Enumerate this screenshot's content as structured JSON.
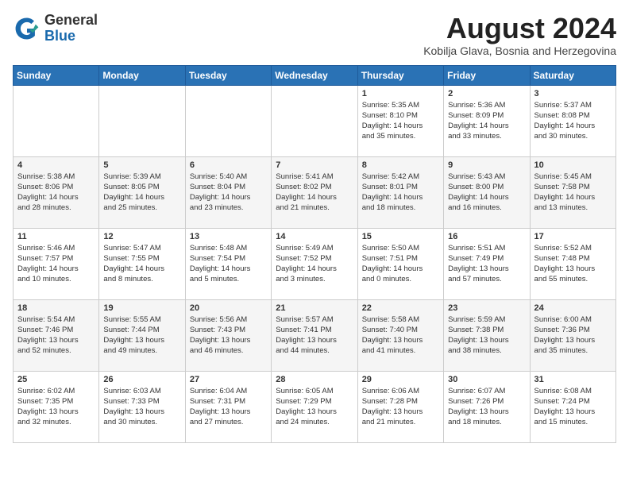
{
  "header": {
    "logo_general": "General",
    "logo_blue": "Blue",
    "title": "August 2024",
    "subtitle": "Kobilja Glava, Bosnia and Herzegovina"
  },
  "days_of_week": [
    "Sunday",
    "Monday",
    "Tuesday",
    "Wednesday",
    "Thursday",
    "Friday",
    "Saturday"
  ],
  "weeks": [
    [
      {
        "day": "",
        "info": ""
      },
      {
        "day": "",
        "info": ""
      },
      {
        "day": "",
        "info": ""
      },
      {
        "day": "",
        "info": ""
      },
      {
        "day": "1",
        "info": "Sunrise: 5:35 AM\nSunset: 8:10 PM\nDaylight: 14 hours\nand 35 minutes."
      },
      {
        "day": "2",
        "info": "Sunrise: 5:36 AM\nSunset: 8:09 PM\nDaylight: 14 hours\nand 33 minutes."
      },
      {
        "day": "3",
        "info": "Sunrise: 5:37 AM\nSunset: 8:08 PM\nDaylight: 14 hours\nand 30 minutes."
      }
    ],
    [
      {
        "day": "4",
        "info": "Sunrise: 5:38 AM\nSunset: 8:06 PM\nDaylight: 14 hours\nand 28 minutes."
      },
      {
        "day": "5",
        "info": "Sunrise: 5:39 AM\nSunset: 8:05 PM\nDaylight: 14 hours\nand 25 minutes."
      },
      {
        "day": "6",
        "info": "Sunrise: 5:40 AM\nSunset: 8:04 PM\nDaylight: 14 hours\nand 23 minutes."
      },
      {
        "day": "7",
        "info": "Sunrise: 5:41 AM\nSunset: 8:02 PM\nDaylight: 14 hours\nand 21 minutes."
      },
      {
        "day": "8",
        "info": "Sunrise: 5:42 AM\nSunset: 8:01 PM\nDaylight: 14 hours\nand 18 minutes."
      },
      {
        "day": "9",
        "info": "Sunrise: 5:43 AM\nSunset: 8:00 PM\nDaylight: 14 hours\nand 16 minutes."
      },
      {
        "day": "10",
        "info": "Sunrise: 5:45 AM\nSunset: 7:58 PM\nDaylight: 14 hours\nand 13 minutes."
      }
    ],
    [
      {
        "day": "11",
        "info": "Sunrise: 5:46 AM\nSunset: 7:57 PM\nDaylight: 14 hours\nand 10 minutes."
      },
      {
        "day": "12",
        "info": "Sunrise: 5:47 AM\nSunset: 7:55 PM\nDaylight: 14 hours\nand 8 minutes."
      },
      {
        "day": "13",
        "info": "Sunrise: 5:48 AM\nSunset: 7:54 PM\nDaylight: 14 hours\nand 5 minutes."
      },
      {
        "day": "14",
        "info": "Sunrise: 5:49 AM\nSunset: 7:52 PM\nDaylight: 14 hours\nand 3 minutes."
      },
      {
        "day": "15",
        "info": "Sunrise: 5:50 AM\nSunset: 7:51 PM\nDaylight: 14 hours\nand 0 minutes."
      },
      {
        "day": "16",
        "info": "Sunrise: 5:51 AM\nSunset: 7:49 PM\nDaylight: 13 hours\nand 57 minutes."
      },
      {
        "day": "17",
        "info": "Sunrise: 5:52 AM\nSunset: 7:48 PM\nDaylight: 13 hours\nand 55 minutes."
      }
    ],
    [
      {
        "day": "18",
        "info": "Sunrise: 5:54 AM\nSunset: 7:46 PM\nDaylight: 13 hours\nand 52 minutes."
      },
      {
        "day": "19",
        "info": "Sunrise: 5:55 AM\nSunset: 7:44 PM\nDaylight: 13 hours\nand 49 minutes."
      },
      {
        "day": "20",
        "info": "Sunrise: 5:56 AM\nSunset: 7:43 PM\nDaylight: 13 hours\nand 46 minutes."
      },
      {
        "day": "21",
        "info": "Sunrise: 5:57 AM\nSunset: 7:41 PM\nDaylight: 13 hours\nand 44 minutes."
      },
      {
        "day": "22",
        "info": "Sunrise: 5:58 AM\nSunset: 7:40 PM\nDaylight: 13 hours\nand 41 minutes."
      },
      {
        "day": "23",
        "info": "Sunrise: 5:59 AM\nSunset: 7:38 PM\nDaylight: 13 hours\nand 38 minutes."
      },
      {
        "day": "24",
        "info": "Sunrise: 6:00 AM\nSunset: 7:36 PM\nDaylight: 13 hours\nand 35 minutes."
      }
    ],
    [
      {
        "day": "25",
        "info": "Sunrise: 6:02 AM\nSunset: 7:35 PM\nDaylight: 13 hours\nand 32 minutes."
      },
      {
        "day": "26",
        "info": "Sunrise: 6:03 AM\nSunset: 7:33 PM\nDaylight: 13 hours\nand 30 minutes."
      },
      {
        "day": "27",
        "info": "Sunrise: 6:04 AM\nSunset: 7:31 PM\nDaylight: 13 hours\nand 27 minutes."
      },
      {
        "day": "28",
        "info": "Sunrise: 6:05 AM\nSunset: 7:29 PM\nDaylight: 13 hours\nand 24 minutes."
      },
      {
        "day": "29",
        "info": "Sunrise: 6:06 AM\nSunset: 7:28 PM\nDaylight: 13 hours\nand 21 minutes."
      },
      {
        "day": "30",
        "info": "Sunrise: 6:07 AM\nSunset: 7:26 PM\nDaylight: 13 hours\nand 18 minutes."
      },
      {
        "day": "31",
        "info": "Sunrise: 6:08 AM\nSunset: 7:24 PM\nDaylight: 13 hours\nand 15 minutes."
      }
    ]
  ]
}
